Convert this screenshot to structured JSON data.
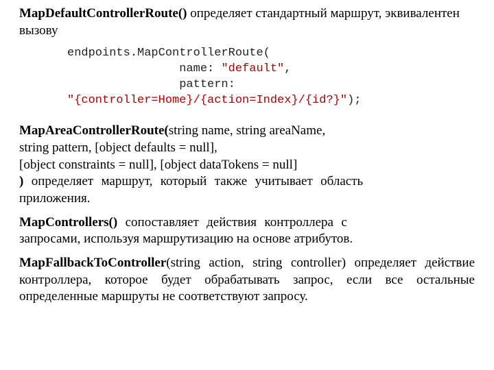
{
  "p1": {
    "method": "MapDefaultControllerRoute()",
    "text": " определяет стандартный маршрут, эквивалентен вызову"
  },
  "code": {
    "l1a": "endpoints.MapControllerRoute(",
    "l2a": "                name: ",
    "l2b": "\"default\"",
    "l2c": ",",
    "l3a": "                pattern: ",
    "l4a": "\"{controller=Home}/{action=Index}/{id?}\"",
    "l4b": ");"
  },
  "p2": {
    "method": "MapAreaControllerRoute(",
    "sig1": "string name, string areaName,",
    "sig2": "string pattern, [object defaults = null],",
    "sig3": "[object constraints = null], [object dataTokens = null]",
    "close": ")",
    "textline": " определяет маршрут, который также учитывает область",
    "text2": "приложения."
  },
  "p3": {
    "method": "MapControllers()",
    "line1": " сопоставляет    действия    контроллера    с",
    "line2": "запросами, используя маршрутизацию на основе атрибутов."
  },
  "p4": {
    "method": "MapFallbackToController",
    "sig": "(string action, string controller)",
    "text": " определяет действие контроллера, которое будет обрабатывать запрос, если все остальные определенные маршруты не соответствуют запросу."
  }
}
